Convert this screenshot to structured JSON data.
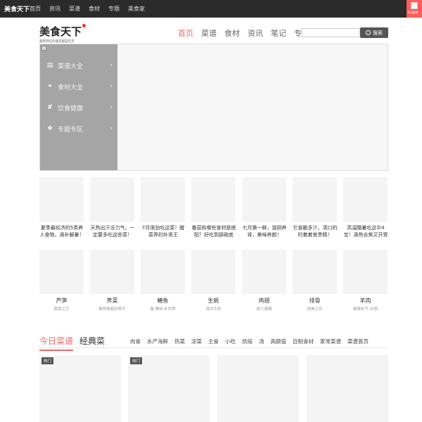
{
  "topbar": {
    "logo": "美食天下",
    "links": [
      "首页",
      "资讯",
      "菜谱",
      "食材",
      "专题",
      "美食家"
    ],
    "app_label": "手机美食"
  },
  "header": {
    "brand": "美食天下",
    "slogan": "最用得吃的朋友都是吃货",
    "nav": [
      {
        "label": "首页",
        "active": true
      },
      {
        "label": "菜谱",
        "active": false
      },
      {
        "label": "食材",
        "active": false
      },
      {
        "label": "资讯",
        "active": false
      },
      {
        "label": "笔记",
        "active": false
      },
      {
        "label": "专题",
        "active": false
      }
    ],
    "search_placeholder": "",
    "search_button": "搜索"
  },
  "categories": [
    {
      "icon": "book-icon",
      "label": "菜谱大全"
    },
    {
      "icon": "apple-icon",
      "label": "食材大全"
    },
    {
      "icon": "pill-icon",
      "label": "饮食健康"
    },
    {
      "icon": "grid-icon",
      "label": "专题专区"
    }
  ],
  "features": [
    "夏季最经济的5类养人食物，滴补解暑！",
    "天热出汗没力气，一定要多吃这些菜！",
    "7月很劲吃这菜！醒菜界的补肾王",
    "番茄和哪些食材是搭配？好吃到舔碗底",
    "七月第一鲜，滋阴养肾，美味养颜！",
    "它香脆多汁，清口的时着着官贵精！",
    "高温酷暑吃这中4宝！滴热去焦又开胃"
  ],
  "ingredients": [
    {
      "name": "芦笋",
      "sub": "蔬菜之王"
    },
    {
      "name": "荠菜",
      "sub": "推荐奉献好帮手"
    },
    {
      "name": "鳝鱼",
      "sub": "蛋·美味·补钙等"
    },
    {
      "name": "生蚝",
      "sub": "海中牛奶"
    },
    {
      "name": "鸡翅",
      "sub": "皮少满嘴"
    },
    {
      "name": "排骨",
      "sub": "肉骨之乐"
    },
    {
      "name": "羊肉",
      "sub": "御寒补气·补阴"
    }
  ],
  "section": {
    "tabs": [
      {
        "label": "今日菜谱",
        "active": true
      },
      {
        "label": "经典菜",
        "active": false
      }
    ],
    "subnav": [
      "肉食",
      "水产海鲜",
      "热菜",
      "凉菜",
      "主食",
      "小吃",
      "烘焙",
      "汤",
      "高颜值",
      "自制食材",
      "家常菜谱",
      "菜谱首页"
    ]
  },
  "cards": [
    {
      "badge": "热门"
    },
    {
      "badge": "热门"
    },
    {
      "badge": ""
    },
    {
      "badge": ""
    }
  ],
  "colors": {
    "accent": "#e86a6a",
    "topbar": "#2b2b2b",
    "menu": "#a5a5a5"
  }
}
